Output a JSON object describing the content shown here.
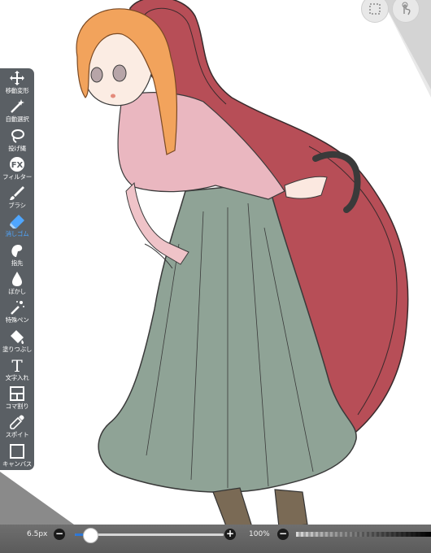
{
  "toolbar": {
    "items": [
      {
        "label": "移動変形",
        "icon": "move-icon",
        "active": false
      },
      {
        "label": "自動選択",
        "icon": "magic-wand-icon",
        "active": false
      },
      {
        "label": "投げ縄",
        "icon": "lasso-icon",
        "active": false
      },
      {
        "label": "フィルター",
        "icon": "fx-icon",
        "glyph": "FX",
        "active": false
      },
      {
        "label": "ブラシ",
        "icon": "brush-icon",
        "active": false
      },
      {
        "label": "消しゴム",
        "icon": "eraser-icon",
        "active": true
      },
      {
        "label": "指先",
        "icon": "finger-icon",
        "active": false
      },
      {
        "label": "ぼかし",
        "icon": "blur-drop-icon",
        "active": false
      },
      {
        "label": "特殊ペン",
        "icon": "special-pen-icon",
        "active": false
      },
      {
        "label": "塗りつぶし",
        "icon": "bucket-icon",
        "active": false
      },
      {
        "label": "文字入れ",
        "icon": "text-icon",
        "glyph": "T",
        "active": false
      },
      {
        "label": "コマ割り",
        "icon": "frame-divider-icon",
        "active": false
      },
      {
        "label": "スポイト",
        "icon": "eyedropper-icon",
        "active": false
      },
      {
        "label": "キャンバス",
        "icon": "canvas-icon",
        "active": false
      }
    ]
  },
  "top_buttons": {
    "selection": "selection-icon",
    "touch": "touch-hand-icon"
  },
  "bottom_bar": {
    "brush_size": "6.5px",
    "brush_size_fraction": 0.1,
    "opacity": "100%",
    "minus_glyph": "−",
    "plus_glyph": "+"
  },
  "colors": {
    "toolbar_bg": "#555a5f",
    "active_tool": "#4aa4ff",
    "slider_accent": "#2b77d8"
  }
}
